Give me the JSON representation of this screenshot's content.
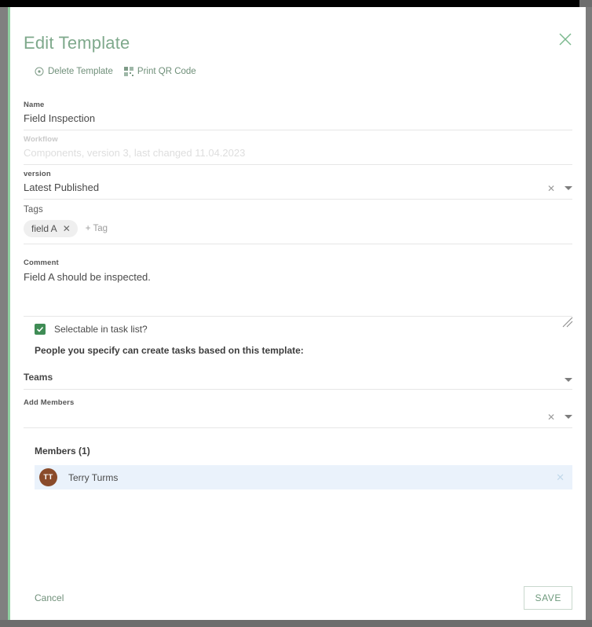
{
  "dialog": {
    "title": "Edit Template",
    "close_icon": "close-icon"
  },
  "actions": {
    "delete": {
      "label": "Delete Template",
      "icon": "delete-circle-icon"
    },
    "print_qr": {
      "label": "Print QR Code",
      "icon": "qr-code-icon"
    }
  },
  "fields": {
    "name": {
      "label": "Name",
      "value": "Field Inspection"
    },
    "workflow": {
      "label": "Workflow",
      "value": "Components, version 3, last changed 11.04.2023"
    },
    "version": {
      "label": "version",
      "value": "Latest Published",
      "clear_icon": "clear-x-icon",
      "caret_icon": "chevron-down-icon"
    },
    "tags": {
      "label": "Tags",
      "chips": [
        {
          "label": "field A",
          "remove_icon": "remove-x-icon"
        }
      ],
      "add_label": "+ Tag"
    },
    "comment": {
      "label": "Comment",
      "value": "Field A should be inspected.",
      "resize_icon": "resize-grip-icon"
    }
  },
  "permissions": {
    "selectable_label": "Selectable in task list?",
    "selectable_checked": true,
    "note": "People you specify can create tasks based on this template:",
    "teams": {
      "label": "Teams",
      "caret_icon": "chevron-down-icon"
    },
    "add_members": {
      "label": "Add Members",
      "value": "",
      "clear_icon": "clear-x-icon",
      "caret_icon": "chevron-down-icon"
    }
  },
  "members": {
    "title": "Members (1)",
    "list": [
      {
        "initials": "TT",
        "name": "Terry Turms",
        "remove_icon": "remove-x-icon"
      }
    ]
  },
  "footer": {
    "cancel_label": "Cancel",
    "save_label": "SAVE"
  },
  "colors": {
    "accent_green": "#7fa98c",
    "checkbox_green": "#3f8c55",
    "avatar_brown": "#8a4b2a",
    "member_row_blue": "#eaf2fb",
    "left_accent": "#8fcfa0"
  }
}
